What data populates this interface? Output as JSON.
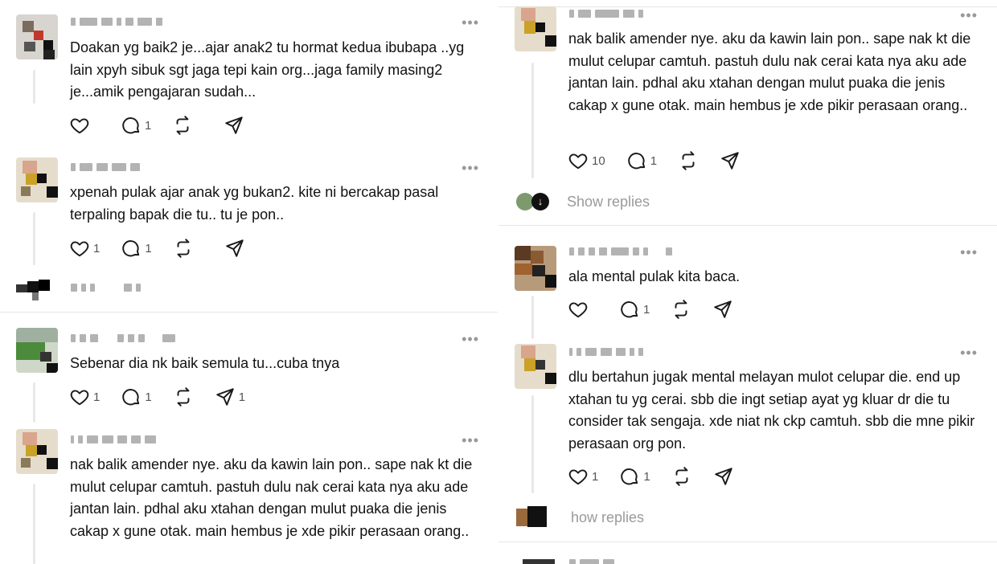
{
  "left": {
    "posts": [
      {
        "text": "Doakan yg baik2 je...ajar anak2 tu hormat kedua ibubapa ..yg lain xpyh sibuk sgt jaga tepi kain org...jaga family masing2 je...amik pengajaran sudah...",
        "likes": "",
        "replies": "1",
        "shares": ""
      },
      {
        "text": "xpenah pulak ajar anak yg bukan2. kite ni bercakap pasal terpaling bapak die tu.. tu je pon..",
        "likes": "1",
        "replies": "1",
        "shares": ""
      },
      {
        "text": "Sebenar dia nk baik semula tu...cuba tnya",
        "likes": "1",
        "replies": "1",
        "shares": "1"
      },
      {
        "text": "nak balik amender nye. aku da kawin lain pon.. sape nak kt die mulut celupar camtuh. pastuh dulu nak cerai kata nya aku ade jantan lain. pdhal aku xtahan dengan mulut puaka die jenis cakap x gune otak. main hembus je xde pikir perasaan orang..",
        "likes": "",
        "replies": "",
        "shares": ""
      }
    ]
  },
  "right": {
    "posts": [
      {
        "text": "nak balik amender nye. aku da kawin lain pon.. sape nak kt die mulut celupar camtuh. pastuh dulu nak cerai kata nya aku ade jantan lain. pdhal aku xtahan dengan mulut puaka die jenis cakap x gune otak. main hembus je xde pikir perasaan orang..",
        "likes": "10",
        "replies": "1",
        "shares": ""
      },
      {
        "text": "ala mental pulak kita baca.",
        "likes": "",
        "replies": "1",
        "shares": ""
      },
      {
        "text": "dlu bertahun jugak mental melayan mulot celupar die. end up xtahan tu yg cerai. sbb die ingt setiap ayat yg kluar dr die tu consider tak sengaja. xde niat nk ckp camtuh. sbb die mne pikir perasaan org pon.",
        "likes": "1",
        "replies": "1",
        "shares": ""
      }
    ],
    "show_replies_1": "Show replies",
    "show_replies_2": "how replies"
  },
  "icons": {
    "like": "heart-icon",
    "reply": "comment-icon",
    "repost": "repost-icon",
    "share": "send-icon",
    "more": "more-icon"
  },
  "more_glyph": "•••"
}
